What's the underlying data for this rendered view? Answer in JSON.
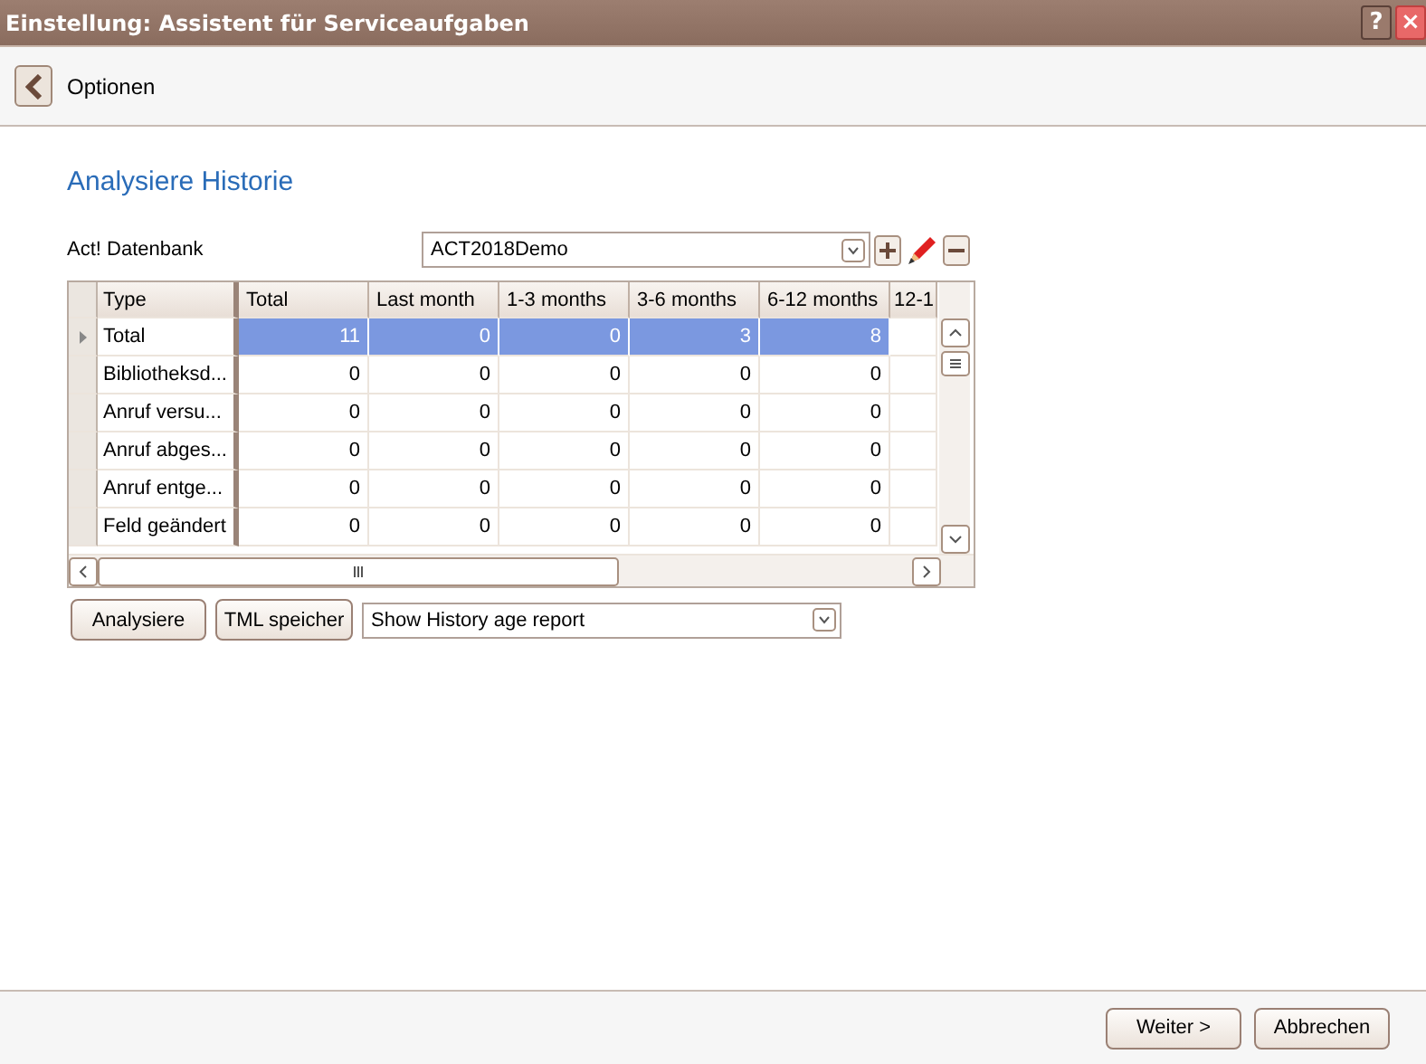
{
  "window": {
    "title": "Einstellung: Assistent für Serviceaufgaben",
    "buttons": [
      {
        "kind": "help",
        "label": "?"
      },
      {
        "kind": "close",
        "label": "×"
      }
    ]
  },
  "header": {
    "title": "Optionen"
  },
  "page": {
    "heading": "Analysiere Historie",
    "database": {
      "label": "Act! Datenbank",
      "value": "ACT2018Demo"
    }
  },
  "table": {
    "columns": [
      "Type",
      "Total",
      "Last month",
      "1-3 months",
      "3-6 months",
      "6-12 months",
      "12-1"
    ],
    "rows": [
      {
        "selected": true,
        "cells": [
          "Total",
          "11",
          "0",
          "0",
          "3",
          "8"
        ]
      },
      {
        "selected": false,
        "cells": [
          "Bibliotheksd...",
          "0",
          "0",
          "0",
          "0",
          "0"
        ]
      },
      {
        "selected": false,
        "cells": [
          "Anruf versu...",
          "0",
          "0",
          "0",
          "0",
          "0"
        ]
      },
      {
        "selected": false,
        "cells": [
          "Anruf abges...",
          "0",
          "0",
          "0",
          "0",
          "0"
        ]
      },
      {
        "selected": false,
        "cells": [
          "Anruf entge...",
          "0",
          "0",
          "0",
          "0",
          "0"
        ]
      },
      {
        "selected": false,
        "cells": [
          "Feld geändert",
          "0",
          "0",
          "0",
          "0",
          "0"
        ]
      }
    ]
  },
  "actions": {
    "buttons": [
      "Analysiere",
      "TML speicher"
    ],
    "report": "Show History age report"
  },
  "footer": {
    "buttons": [
      "Weiter >",
      "Abbrechen"
    ]
  }
}
